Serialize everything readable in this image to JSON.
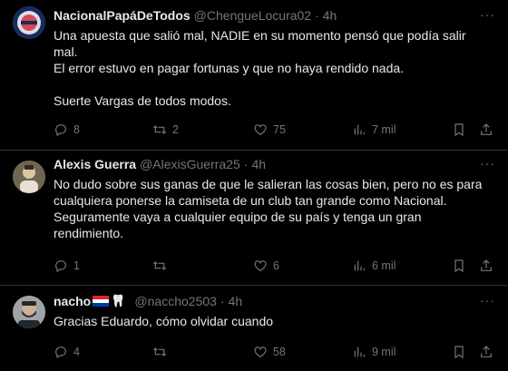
{
  "tweets": [
    {
      "name": "NacionalPapáDeTodos",
      "handle": "@ChengueLocura02",
      "time": "4h",
      "more": "···",
      "text": "Una apuesta que salió mal, NADIE en su momento pensó que podía salir\nmal.\nEl error estuvo en pagar fortunas y que no haya rendido nada.\n\nSuerte Vargas de todos modos.",
      "replies": "8",
      "reposts": "2",
      "likes": "75",
      "views": "7 mil",
      "avatar_icon": "avatar-crest"
    },
    {
      "name": "Alexis Guerra",
      "handle": "@AlexisGuerra25",
      "time": "4h",
      "more": "···",
      "text": "No dudo sobre sus ganas de que le salieran las cosas bien, pero no es para\ncualquiera ponerse la camiseta de un club tan grande como Nacional.\nSeguramente vaya a cualquier equipo de su país y tenga un gran\nrendimiento.",
      "replies": "1",
      "reposts": "",
      "likes": "6",
      "views": "6 mil",
      "avatar_icon": "avatar-photo"
    },
    {
      "name": "nacho",
      "handle": "@naccho2503",
      "time": "4h",
      "more": "···",
      "text": "Gracias Eduardo, cómo olvidar cuando",
      "replies": "4",
      "reposts": "",
      "likes": "58",
      "views": "9 mil",
      "avatar_icon": "avatar-bearded",
      "name_badges": [
        "paraguay-flag",
        "tooth-emoji"
      ]
    }
  ],
  "colors": {
    "background": "#000000",
    "text": "#e7e9ea",
    "muted": "#71767b",
    "divider": "#2f3336"
  }
}
